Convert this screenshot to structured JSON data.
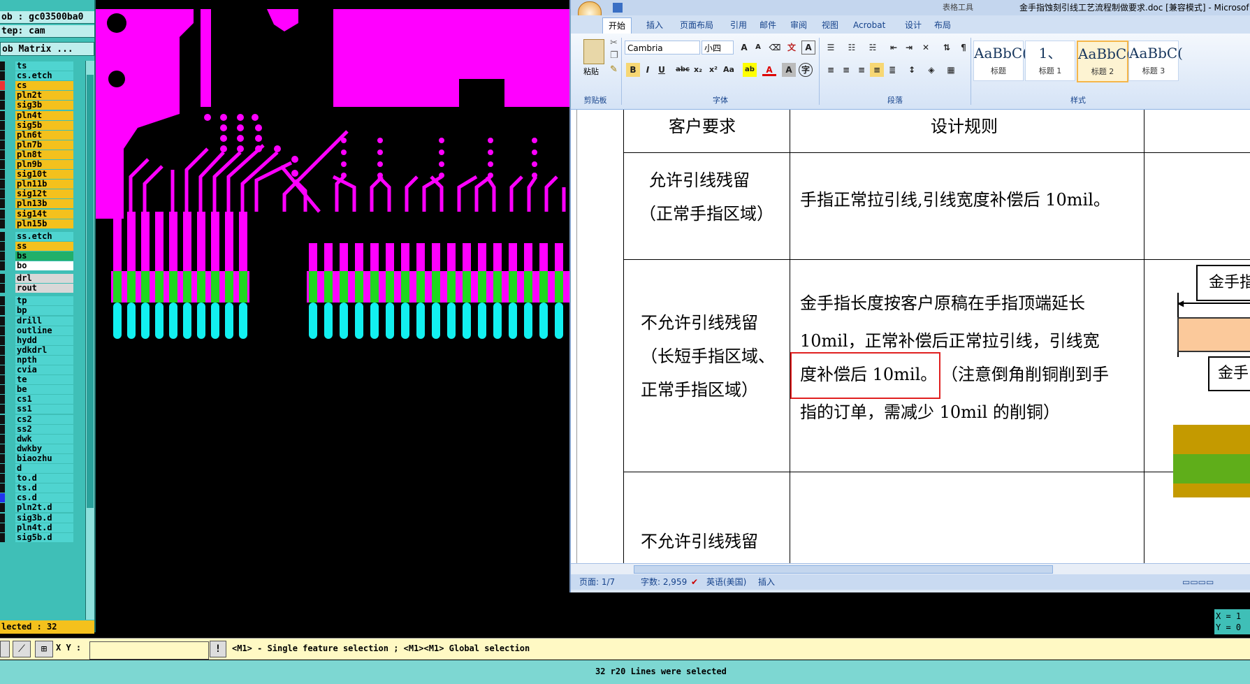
{
  "cam": {
    "job": "ob : gc03500ba0",
    "step": "tep: cam",
    "matrix_button": "ob Matrix ...",
    "selected_count": "lected : 32",
    "layers": [
      {
        "name": "ts",
        "color": "cyan"
      },
      {
        "name": "cs.etch",
        "color": "cyan"
      },
      {
        "name": "cs",
        "color": "yellow"
      },
      {
        "name": "pln2t",
        "color": "yellow"
      },
      {
        "name": "sig3b",
        "color": "yellow"
      },
      {
        "name": "pln4t",
        "color": "yellow"
      },
      {
        "name": "sig5b",
        "color": "yellow"
      },
      {
        "name": "pln6t",
        "color": "yellow"
      },
      {
        "name": "pln7b",
        "color": "yellow"
      },
      {
        "name": "pln8t",
        "color": "yellow"
      },
      {
        "name": "pln9b",
        "color": "yellow"
      },
      {
        "name": "sig10t",
        "color": "yellow"
      },
      {
        "name": "pln11b",
        "color": "yellow"
      },
      {
        "name": "sig12t",
        "color": "yellow"
      },
      {
        "name": "pln13b",
        "color": "yellow"
      },
      {
        "name": "sig14t",
        "color": "yellow"
      },
      {
        "name": "pln15b",
        "color": "yellow"
      },
      {
        "name": "ss.etch",
        "color": "cyan"
      },
      {
        "name": "ss",
        "color": "yellow"
      },
      {
        "name": "bs",
        "color": "green"
      },
      {
        "name": "bo",
        "color": "white"
      },
      {
        "name": "drl",
        "color": "gray"
      },
      {
        "name": "rout",
        "color": "gray"
      },
      {
        "name": "tp",
        "color": "cyan"
      },
      {
        "name": "bp",
        "color": "cyan"
      },
      {
        "name": "drill",
        "color": "cyan"
      },
      {
        "name": "outline",
        "color": "cyan"
      },
      {
        "name": "hydd",
        "color": "cyan"
      },
      {
        "name": "ydkdrl",
        "color": "cyan"
      },
      {
        "name": "npth",
        "color": "cyan"
      },
      {
        "name": "cvia",
        "color": "cyan"
      },
      {
        "name": "te",
        "color": "cyan"
      },
      {
        "name": "be",
        "color": "cyan"
      },
      {
        "name": "cs1",
        "color": "cyan"
      },
      {
        "name": "ss1",
        "color": "cyan"
      },
      {
        "name": "cs2",
        "color": "cyan"
      },
      {
        "name": "ss2",
        "color": "cyan"
      },
      {
        "name": "dwk",
        "color": "cyan"
      },
      {
        "name": "dwkby",
        "color": "cyan"
      },
      {
        "name": "biaozhu",
        "color": "cyan"
      },
      {
        "name": "d",
        "color": "cyan"
      },
      {
        "name": "to.d",
        "color": "cyan"
      },
      {
        "name": "ts.d",
        "color": "cyan"
      },
      {
        "name": "cs.d",
        "color": "cyan"
      },
      {
        "name": "pln2t.d",
        "color": "cyan"
      },
      {
        "name": "sig3b.d",
        "color": "cyan"
      },
      {
        "name": "pln4t.d",
        "color": "cyan"
      },
      {
        "name": "sig5b.d",
        "color": "cyan"
      }
    ],
    "xy_label": "X Y :",
    "xy_value": "",
    "hint": "<M1> - Single feature selection ; <M1><M1> Global selection",
    "message": "32 r20 Lines were selected",
    "coord_x": "X = 1",
    "coord_y": "Y = 0"
  },
  "word": {
    "title": "金手指蚀刻引线工艺流程制做要求.doc [兼容模式] - Microsof",
    "table_tools": "表格工具",
    "tabs": [
      "开始",
      "插入",
      "页面布局",
      "引用",
      "邮件",
      "审阅",
      "视图",
      "Acrobat",
      "设计",
      "布局"
    ],
    "font_name": "Cambria",
    "font_size": "小四",
    "paste_label": "粘贴",
    "groups": {
      "clipboard": "剪贴板",
      "font": "字体",
      "paragraph": "段落",
      "styles": "样式"
    },
    "styles": [
      {
        "preview": "AaBbC(",
        "caption": "标题"
      },
      {
        "preview": "1、",
        "caption": "标题 1"
      },
      {
        "preview": "AaBbC(",
        "caption": "标题 2"
      },
      {
        "preview": "AaBbC(",
        "caption": "标题 3"
      }
    ],
    "table": {
      "header": [
        "客户要求",
        "设计规则"
      ],
      "row1": {
        "req1": "允许引线残留",
        "req2": "（正常手指区域）",
        "rule": "手指正常拉引线,引线宽度补偿后 10mil。"
      },
      "row2": {
        "req1": "不允许引线残留",
        "req2": "（长短手指区域、",
        "req3": "正常手指区域）",
        "rule1": "金手指长度按客户原稿在手指顶端延长",
        "rule2": "10mil，正常补偿后正常拉引线，引线宽",
        "rule3a": "度补偿后 10mil。",
        "rule3b": "（注意倒角削铜削到手",
        "rule4": "指的订单，需减少 10mil 的削铜）"
      },
      "row3": {
        "req1": "不允许引线残留"
      },
      "diagram": {
        "label1": "金手指",
        "label2": "金手"
      }
    },
    "status": {
      "page": "页面: 1/7",
      "words": "字数: 2,959",
      "lang": "英语(美国)",
      "mode": "插入"
    }
  }
}
